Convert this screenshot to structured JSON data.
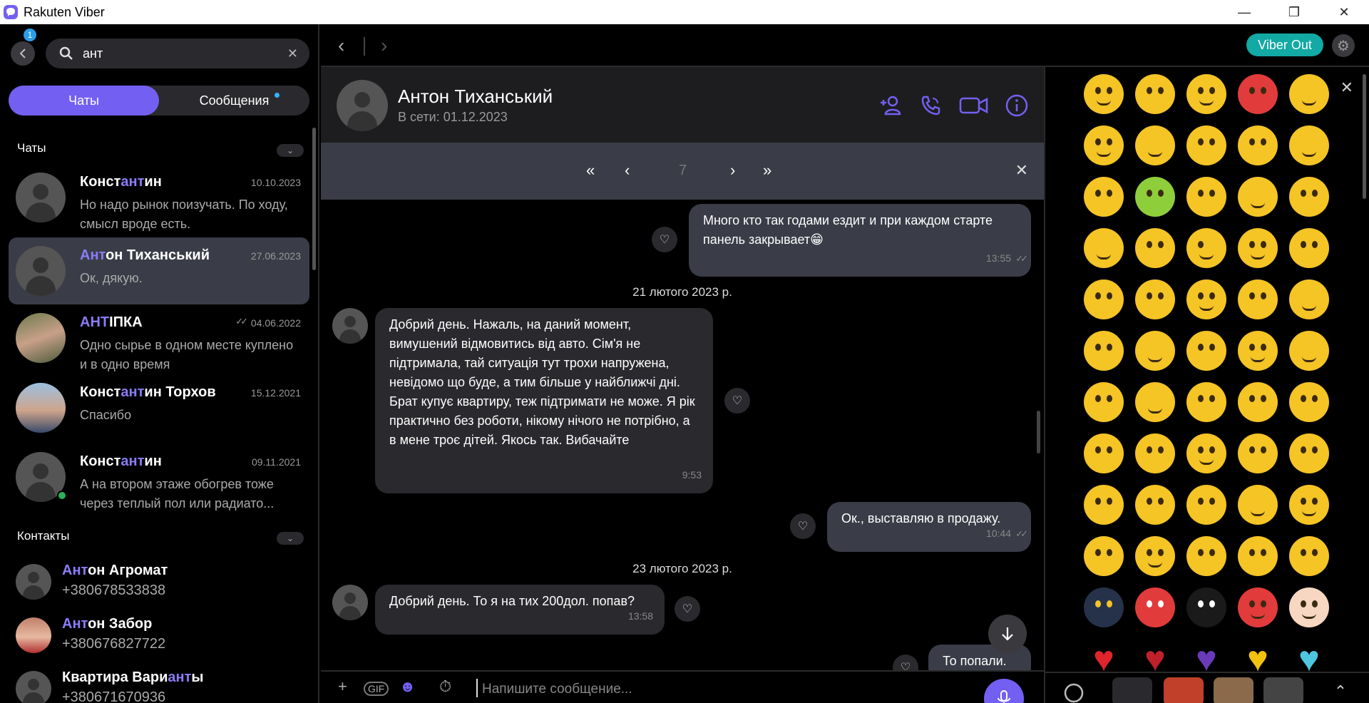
{
  "window": {
    "title": "Rakuten Viber",
    "minimize": "—",
    "restore": "❐",
    "close": "✕"
  },
  "left": {
    "badge": "1",
    "search": {
      "value": "ант",
      "placeholder": ""
    },
    "tabs": [
      {
        "label": "Чаты"
      },
      {
        "label": "Сообщения"
      }
    ],
    "chats_header": "Чаты",
    "contacts_header": "Контакты",
    "chats": [
      {
        "name_pre": "Конст",
        "name_hl": "ант",
        "name_post": "ин",
        "date": "10.10.2023",
        "preview": "Но надо рынок поизучать. По ходу, смысл вроде есть."
      },
      {
        "name_pre": "",
        "name_hl": "Ант",
        "name_post": "он Тиханський",
        "date": "27.06.2023",
        "preview": "Ок, дякую."
      },
      {
        "name_pre": "",
        "name_hl": "АНТ",
        "name_post": "ІПКА",
        "date": "04.06.2022",
        "preview": "Одно сырье в одном месте куплено и в одно время"
      },
      {
        "name_pre": "Конст",
        "name_hl": "ант",
        "name_post": "ин Торхов",
        "date": "15.12.2021",
        "preview": "Спасибо"
      },
      {
        "name_pre": "Конст",
        "name_hl": "ант",
        "name_post": "ин",
        "date": "09.11.2021",
        "preview": "А на втором этаже обогрев тоже через теплый пол или радиато..."
      }
    ],
    "contacts": [
      {
        "name_pre": "",
        "name_hl": "Ант",
        "name_post": "он Агромат",
        "phone": "+380678533838"
      },
      {
        "name_pre": "",
        "name_hl": "Ант",
        "name_post": "он Забор",
        "phone": "+380676827722"
      },
      {
        "name_pre": "Квартира Вари",
        "name_hl": "ант",
        "name_post": "ы",
        "phone": "+380671670936"
      }
    ]
  },
  "topbar": {
    "viber_out": "Viber Out"
  },
  "chat": {
    "name": "Антон Тиханський",
    "status": "В сети: 01.12.2023",
    "search_result_index": "7",
    "messages": [
      {
        "dir": "out",
        "text": "Много кто так годами ездит и при каждом старте панель закрывает😁",
        "time": "13:55"
      },
      {
        "date": "21 лютого 2023 р."
      },
      {
        "dir": "in",
        "text": "Добрий день. Нажаль, на даний момент, вимушений відмовитись від авто. Сім'я не підтримала, тай ситуація тут трохи напружена, невідомо що буде, а тим більше у найближчі дні. Брат купує квартиру, теж підтримати не може. Я рік практично без роботи, нікому нічого не потрібно, а в мене троє дітей. Якось так. Вибачайте",
        "time": "9:53"
      },
      {
        "dir": "out",
        "text": "Ок., выставляю в продажу.",
        "time": "10:44"
      },
      {
        "date": "23 лютого 2023 р."
      },
      {
        "dir": "in",
        "text": "Добрий день. То я на тих 200дол. попав?",
        "time": "13:58"
      },
      {
        "dir": "out",
        "text": "То попали.",
        "time": ""
      }
    ],
    "composer_placeholder": "Напишите сообщение..."
  },
  "emoji_panel": {
    "colors": {
      "accent": "#7360f2",
      "viber_out": "#13a9a4",
      "emoji_yellow": "#f5c425"
    }
  }
}
